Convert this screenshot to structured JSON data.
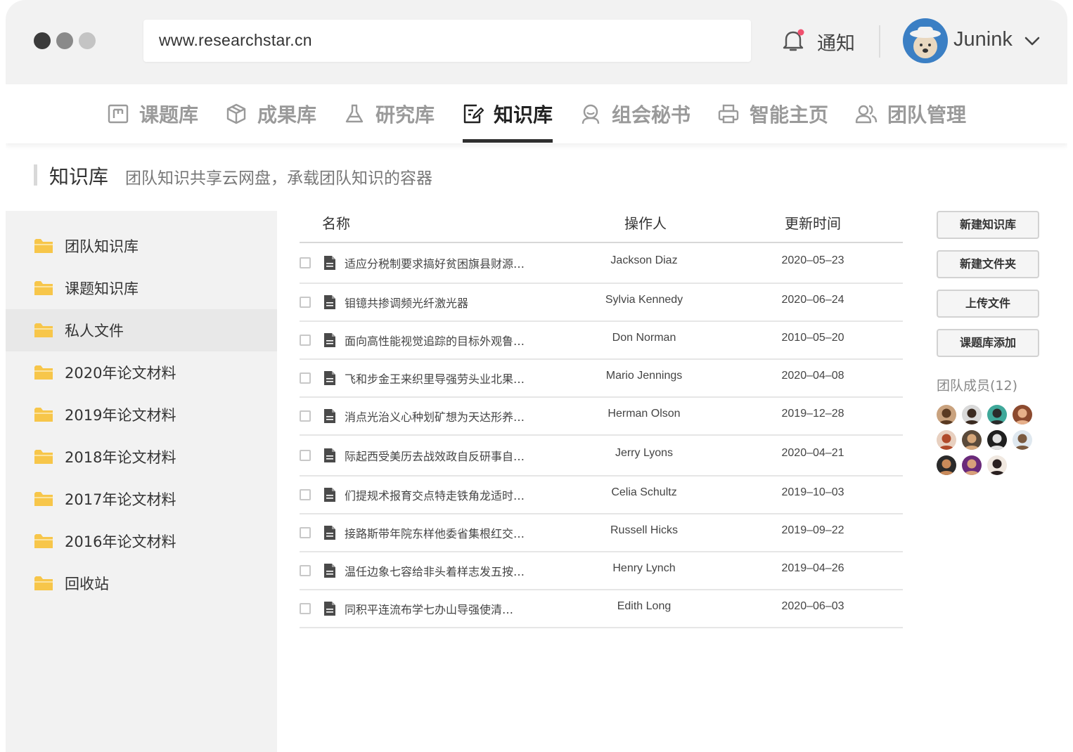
{
  "browser": {
    "url": "www.researchstar.cn",
    "notify_label": "通知",
    "user_name": "Junink"
  },
  "nav": {
    "tabs": [
      {
        "label": "课题库",
        "icon": "topic-bank-icon"
      },
      {
        "label": "成果库",
        "icon": "cube-icon"
      },
      {
        "label": "研究库",
        "icon": "flask-icon"
      },
      {
        "label": "知识库",
        "icon": "edit-doc-icon",
        "active": true
      },
      {
        "label": "组会秘书",
        "icon": "person-icon"
      },
      {
        "label": "智能主页",
        "icon": "printer-icon"
      },
      {
        "label": "团队管理",
        "icon": "team-icon"
      }
    ]
  },
  "page": {
    "title": "知识库",
    "subtitle": "团队知识共享云网盘，承载团队知识的容器"
  },
  "sidebar": {
    "items": [
      {
        "label": "团队知识库"
      },
      {
        "label": "课题知识库"
      },
      {
        "label": "私人文件",
        "selected": true
      },
      {
        "label": "2020年论文材料"
      },
      {
        "label": "2019年论文材料"
      },
      {
        "label": "2018年论文材料"
      },
      {
        "label": "2017年论文材料"
      },
      {
        "label": "2016年论文材料"
      },
      {
        "label": "回收站"
      }
    ]
  },
  "table": {
    "columns": [
      "名称",
      "操作人",
      "更新时间"
    ],
    "rows": [
      {
        "name": "适应分税制要求搞好贫困旗县财源…",
        "operator": "Jackson Diaz",
        "updated": "2020–05–23"
      },
      {
        "name": "钼镱共掺调频光纤激光器",
        "operator": "Sylvia Kennedy",
        "updated": "2020–06–24"
      },
      {
        "name": "面向高性能视觉追踪的目标外观鲁…",
        "operator": "Don Norman",
        "updated": "2010–05–20"
      },
      {
        "name": "飞和步金王来织里导强劳头业北果…",
        "operator": "Mario Jennings",
        "updated": "2020–04–08"
      },
      {
        "name": "消点光治义心种划矿想为天达形养…",
        "operator": "Herman Olson",
        "updated": "2019–12–28"
      },
      {
        "name": "际起西受美历去战效政自反研事自…",
        "operator": "Jerry Lyons",
        "updated": "2020–04–21"
      },
      {
        "name": "们提规术报育交点特走铁角龙适时…",
        "operator": "Celia Schultz",
        "updated": "2019–10–03"
      },
      {
        "name": "接路斯带年院东样他委省集根红交…",
        "operator": "Russell Hicks",
        "updated": "2019–09–22"
      },
      {
        "name": "温任边象七容给非头着样志发五按…",
        "operator": "Henry Lynch",
        "updated": "2019–04–26"
      },
      {
        "name": "同积平连流布学七办山导强使清…",
        "operator": "Edith Long",
        "updated": "2020–06–03"
      }
    ]
  },
  "actions": {
    "new_kb": "新建知识库",
    "new_folder": "新建文件夹",
    "upload": "上传文件",
    "add_from_topic": "课题库添加"
  },
  "members": {
    "title": "团队成员(12)",
    "avatars": [
      {
        "bg": "#c9a27e",
        "fg": "#5a3a22"
      },
      {
        "bg": "#d9d9d9",
        "fg": "#3a2a20"
      },
      {
        "bg": "#3fa89a",
        "fg": "#2b2b2b"
      },
      {
        "bg": "#8c4a2f",
        "fg": "#e7b08a"
      },
      {
        "bg": "#e8d0c0",
        "fg": "#b04a2a"
      },
      {
        "bg": "#5a4a3a",
        "fg": "#d6a77a"
      },
      {
        "bg": "#1f1f1f",
        "fg": "#e0e0e0"
      },
      {
        "bg": "#dfe8ef",
        "fg": "#7a5a40"
      },
      {
        "bg": "#2a2a2a",
        "fg": "#c98a5a"
      },
      {
        "bg": "#6a2a7a",
        "fg": "#d8a07a"
      },
      {
        "bg": "#f0e8e0",
        "fg": "#2a2020"
      }
    ]
  },
  "colors": {
    "folder": "#f7c64a",
    "accent": "#2f2f2f",
    "notify_dot": "#f0506e"
  }
}
